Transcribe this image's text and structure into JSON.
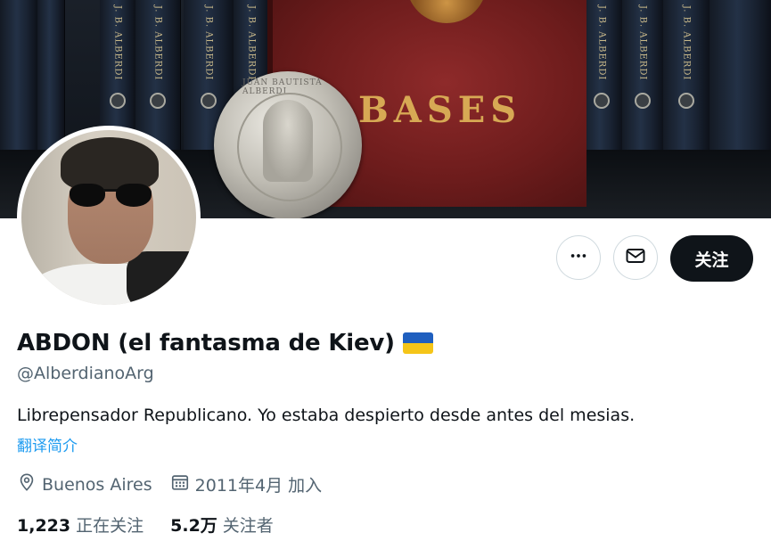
{
  "banner": {
    "spine_label": "J. B. ALBERDI",
    "book_title": "BASES",
    "medal_legend": "JUAN BAUTISTA ALBERDI"
  },
  "actions": {
    "more_icon": "more-horizontal-icon",
    "message_icon": "mail-icon",
    "follow_label": "关注"
  },
  "profile": {
    "display_name": "ABDON (el fantasma de Kiev)",
    "flag": {
      "name": "ukraine-flag",
      "top_color": "#1f5fbf",
      "bottom_color": "#f5c518"
    },
    "handle": "@AlberdianoArg",
    "bio": "Librepensador Republicano. Yo estaba despierto desde antes del mesias.",
    "translate_link": "翻译简介",
    "location": "Buenos Aires",
    "joined": "2011年4月 加入"
  },
  "stats": {
    "following_count": "1,223",
    "following_label": "正在关注",
    "followers_count": "5.2万",
    "followers_label": "关注者"
  },
  "colors": {
    "text_primary": "#0f1419",
    "text_secondary": "#536471",
    "link": "#1d9bf0",
    "follow_bg": "#0f1419"
  }
}
